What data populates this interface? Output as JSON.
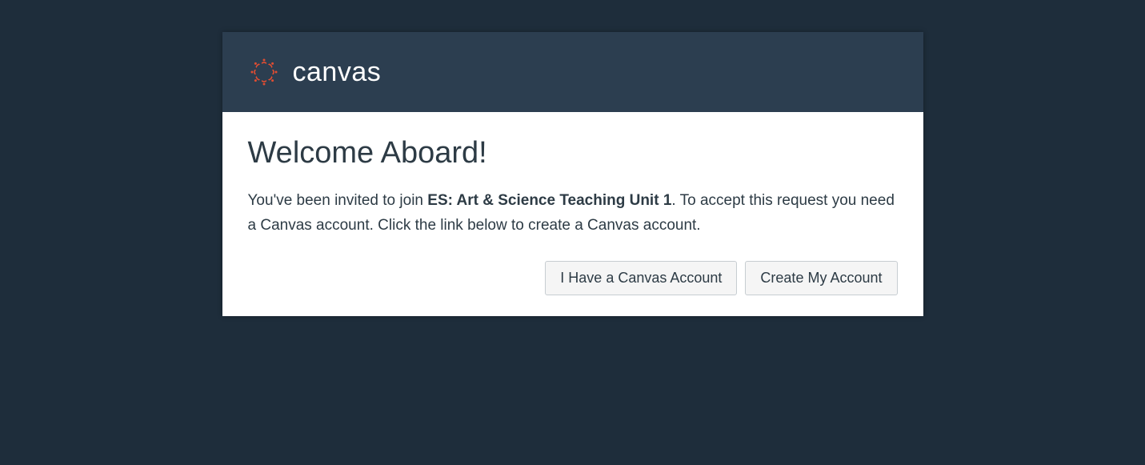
{
  "header": {
    "logo_text": "canvas"
  },
  "body": {
    "heading": "Welcome Aboard!",
    "message_prefix": "You've been invited to join ",
    "course_name": "ES: Art & Science Teaching Unit 1",
    "message_suffix": ". To accept this request you need a Canvas account. Click the link below to create a Canvas account."
  },
  "buttons": {
    "have_account": "I Have a Canvas Account",
    "create_account": "Create My Account"
  }
}
